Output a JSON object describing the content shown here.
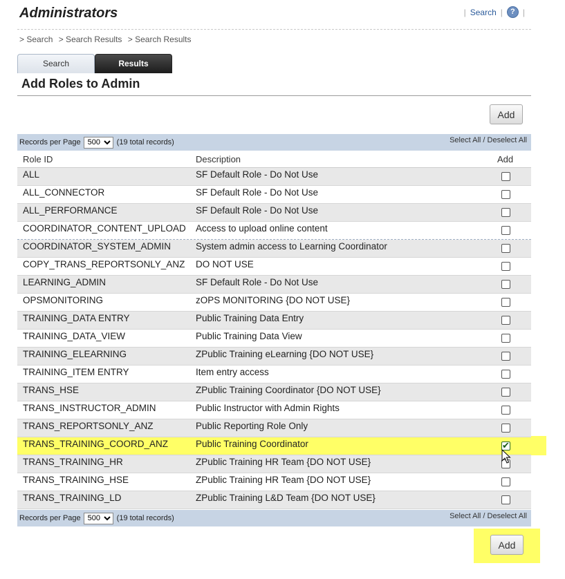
{
  "header": {
    "title": "Administrators",
    "search_link": "Search",
    "help_icon": "question-circle-icon",
    "help_glyph": "?"
  },
  "breadcrumb": [
    "> Search",
    "> Search Results",
    "> Search Results"
  ],
  "tabs": [
    {
      "label": "Search",
      "active": false
    },
    {
      "label": "Results",
      "active": true
    }
  ],
  "section": {
    "title": "Add Roles to Admin"
  },
  "add_button_label": "Add",
  "pager": {
    "label": "Records per Page",
    "value": "500",
    "total": "(19 total records)",
    "select_all": "Select All",
    "separator": " / ",
    "deselect_all": "Deselect All"
  },
  "table": {
    "headers": {
      "role_id": "Role ID",
      "description": "Description",
      "add": "Add"
    },
    "rows": [
      {
        "id": "ALL",
        "desc": "SF Default Role - Do Not Use",
        "checked": false
      },
      {
        "id": "ALL_CONNECTOR",
        "desc": "SF Default Role - Do Not Use",
        "checked": false
      },
      {
        "id": "ALL_PERFORMANCE",
        "desc": "SF Default Role - Do Not Use",
        "checked": false
      },
      {
        "id": "COORDINATOR_CONTENT_UPLOAD",
        "desc": "Access to upload online content",
        "checked": false
      },
      {
        "id": "COORDINATOR_SYSTEM_ADMIN",
        "desc": "System admin access to Learning Coordinator",
        "checked": false
      },
      {
        "id": "COPY_TRANS_REPORTSONLY_ANZ",
        "desc": "DO NOT USE",
        "checked": false
      },
      {
        "id": "LEARNING_ADMIN",
        "desc": "SF Default Role - Do Not Use",
        "checked": false
      },
      {
        "id": "OPSMONITORING",
        "desc": "zOPS MONITORING {DO NOT USE}",
        "checked": false
      },
      {
        "id": "TRAINING_DATA ENTRY",
        "desc": "Public Training Data Entry",
        "checked": false
      },
      {
        "id": "TRAINING_DATA_VIEW",
        "desc": "Public Training Data View",
        "checked": false
      },
      {
        "id": "TRAINING_ELEARNING",
        "desc": "ZPublic Training eLearning {DO NOT USE}",
        "checked": false
      },
      {
        "id": "TRAINING_ITEM ENTRY",
        "desc": "Item entry access",
        "checked": false
      },
      {
        "id": "TRANS_HSE",
        "desc": "ZPublic Training Coordinator {DO NOT USE}",
        "checked": false
      },
      {
        "id": "TRANS_INSTRUCTOR_ADMIN",
        "desc": "Public Instructor with Admin Rights",
        "checked": false
      },
      {
        "id": "TRANS_REPORTSONLY_ANZ",
        "desc": "Public Reporting Role Only",
        "checked": false
      },
      {
        "id": "TRANS_TRAINING_COORD_ANZ",
        "desc": "Public Training Coordinator",
        "checked": true
      },
      {
        "id": "TRANS_TRAINING_HR",
        "desc": "ZPublic Training HR Team {DO NOT USE}",
        "checked": false
      },
      {
        "id": "TRANS_TRAINING_HSE",
        "desc": "ZPublic Training HR Team {DO NOT USE}",
        "checked": false
      },
      {
        "id": "TRANS_TRAINING_LD",
        "desc": "ZPublic Training L&D Team {DO NOT USE}",
        "checked": false
      }
    ]
  },
  "highlight_color": "#ffff66",
  "pager_bar_color": "#c7d4e4"
}
